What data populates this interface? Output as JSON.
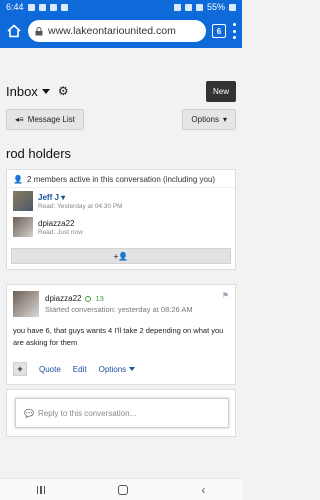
{
  "status": {
    "time": "6:44",
    "battery": "55%"
  },
  "browser": {
    "url": "www.lakeontariounited.com",
    "tabs_count": "6"
  },
  "header": {
    "title": "Inbox",
    "new_label": "New"
  },
  "toolbar": {
    "message_list_label": "Message List",
    "options_label": "Options"
  },
  "conversation": {
    "title": "rod holders"
  },
  "members": {
    "heading": "2 members active in this conversation (including you)",
    "list": [
      {
        "name": "Jeff J",
        "read": "Read: Yesterday at 04:30 PM"
      },
      {
        "name": "dpiazza22",
        "read": "Read: Just now"
      }
    ]
  },
  "message": {
    "author": "dpiazza22",
    "score": "13",
    "started": "Started conversation: yesterday at 08:26 AM",
    "body": "you have 6, that guys wants 4 I'll take 2 depending on what you are asking for them",
    "actions": {
      "quote": "Quote",
      "edit": "Edit",
      "options": "Options"
    }
  },
  "reply": {
    "placeholder": "Reply to this conversation..."
  }
}
